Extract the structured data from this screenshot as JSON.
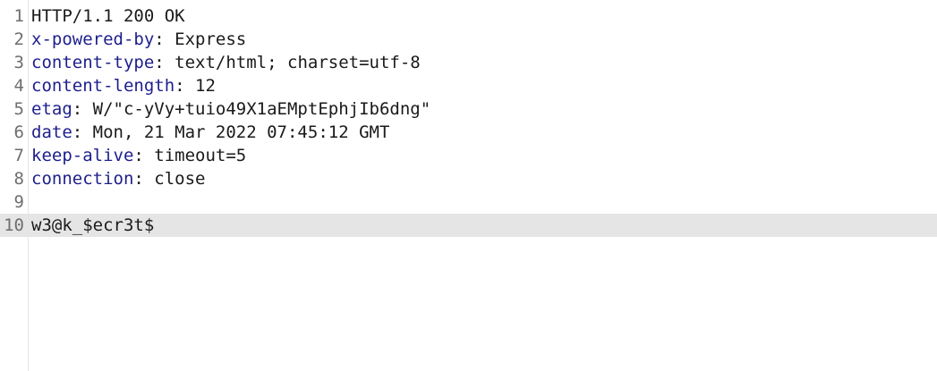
{
  "colors": {
    "header_key": "#1d1f8c",
    "text": "#1a1a1a",
    "line_number": "#6e6e6e",
    "active_line_bg": "#e5e5e5",
    "gutter_border": "#e6e6e6"
  },
  "response": {
    "lines": [
      {
        "number": "1",
        "text": "HTTP/1.1 200 OK"
      },
      {
        "number": "2",
        "key": "x-powered-by",
        "sep": ":",
        "value": " Express"
      },
      {
        "number": "3",
        "key": "content-type",
        "sep": ":",
        "value": " text/html; charset=utf-8"
      },
      {
        "number": "4",
        "key": "content-length",
        "sep": ":",
        "value": " 12"
      },
      {
        "number": "5",
        "key": "etag",
        "sep": ":",
        "value": " W/\"c-yVy+tuio49X1aEMptEphjIb6dng\""
      },
      {
        "number": "6",
        "key": "date",
        "sep": ":",
        "value": " Mon, 21 Mar 2022 07:45:12 GMT"
      },
      {
        "number": "7",
        "key": "keep-alive",
        "sep": ":",
        "value": " timeout=5"
      },
      {
        "number": "8",
        "key": "connection",
        "sep": ":",
        "value": " close"
      },
      {
        "number": "9",
        "text": ""
      },
      {
        "number": "10",
        "text": "w3@k_$ecr3t$",
        "active": true
      }
    ]
  }
}
